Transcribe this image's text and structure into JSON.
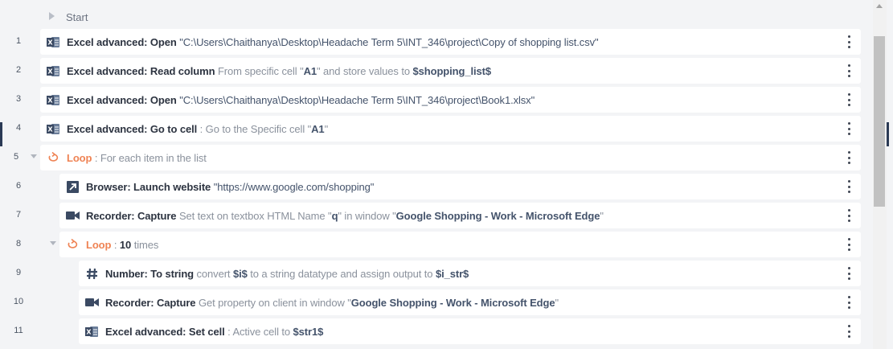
{
  "start": {
    "label": "Start"
  },
  "rows": [
    {
      "num": "1",
      "action": "Excel advanced: Open",
      "q1": "\"",
      "v1": "C:\\Users\\Chaithanya\\Desktop\\Headache Term 5\\INT_346\\project\\Copy of shopping list.csv",
      "q2": "\""
    },
    {
      "num": "2",
      "action": "Excel advanced: Read column",
      "d1": " From specific cell \"",
      "v1": "A1",
      "d2": "\" and store values to ",
      "v2": "$shopping_list$"
    },
    {
      "num": "3",
      "action": "Excel advanced: Open",
      "q1": "\"",
      "v1": "C:\\Users\\Chaithanya\\Desktop\\Headache Term 5\\INT_346\\project\\Book1.xlsx",
      "q2": "\""
    },
    {
      "num": "4",
      "action": "Excel advanced: Go to cell",
      "d1": " : Go to the Specific cell \"",
      "v1": "A1",
      "d2": "\""
    },
    {
      "num": "5",
      "loop": "Loop",
      "d1": " : For each item in the list"
    },
    {
      "num": "6",
      "action": "Browser: Launch website",
      "q1": " \"",
      "v1": "https://www.google.com/shopping",
      "q2": "\""
    },
    {
      "num": "7",
      "action": "Recorder: Capture",
      "d1": " Set text on textbox HTML Name \"",
      "v1": "q",
      "d2": "\" in window \"",
      "v2": "Google Shopping - Work - Microsoft Edge",
      "d3": "\""
    },
    {
      "num": "8",
      "loop": "Loop",
      "d1": " : ",
      "v1": "10",
      "d2": " times"
    },
    {
      "num": "9",
      "action": "Number: To string",
      "d1": " convert ",
      "v1": "$i$",
      "d2": " to a string datatype and assign output to ",
      "v2": "$i_str$"
    },
    {
      "num": "10",
      "action": "Recorder: Capture",
      "d1": " Get property on client in window \"",
      "v1": "Google Shopping - Work - Microsoft Edge",
      "d2": "\""
    },
    {
      "num": "11",
      "action": "Excel advanced: Set cell",
      "d1": " : Active cell to ",
      "v1": "$str1$"
    }
  ],
  "icons": {
    "excel": "excel-icon",
    "loop": "loop-icon",
    "browser": "launch-arrow-icon",
    "recorder": "video-camera-icon",
    "number": "hash-icon",
    "menu": "more-vertical-icon"
  },
  "colors": {
    "excel": "#4a5d78",
    "loop": "#ef8354",
    "value": "#44536b",
    "muted": "#8a919c"
  }
}
